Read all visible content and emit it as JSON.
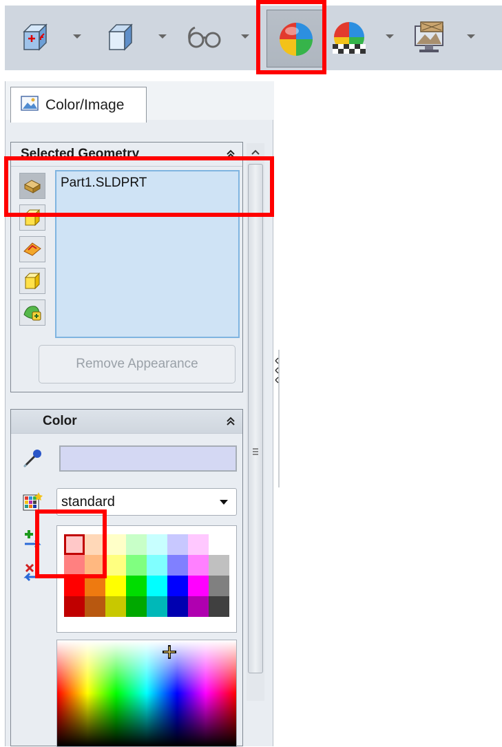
{
  "toolbar": {
    "buttons": [
      {
        "name": "view-orientation-icon"
      },
      {
        "name": "display-style-icon"
      },
      {
        "name": "hide-show-items-icon"
      },
      {
        "name": "edit-appearance-icon"
      },
      {
        "name": "apply-scene-icon"
      },
      {
        "name": "view-settings-icon"
      }
    ]
  },
  "panel": {
    "tab_label": "Color/Image",
    "selected_geometry": {
      "title": "Selected Geometry",
      "items": [
        "Part1.SLDPRT"
      ],
      "remove_button": "Remove Appearance"
    },
    "color": {
      "title": "Color",
      "hex_value": "",
      "palette": "standard",
      "swatch_colors": [
        "#ffc8c8",
        "#ffd8b8",
        "#ffffc8",
        "#c8ffc8",
        "#c8ffff",
        "#c8c8ff",
        "#ffc8ff",
        "#ffffff",
        "#ff8080",
        "#ffb880",
        "#ffff80",
        "#80ff80",
        "#80ffff",
        "#8080ff",
        "#ff80ff",
        "#c0c0c0",
        "#ff0000",
        "#ee7a10",
        "#ffff00",
        "#00dd00",
        "#00ffff",
        "#0000ff",
        "#ff00ff",
        "#808080",
        "#c00000",
        "#b85810",
        "#c8c800",
        "#00a800",
        "#00b8b8",
        "#0000b0",
        "#b000b0",
        "#404040"
      ]
    }
  },
  "colors": {
    "highlight": "#ff0000",
    "toolbar_bg": "#cfd6df",
    "panel_bg": "#e9edf2",
    "list_bg": "#cfe3f5"
  }
}
